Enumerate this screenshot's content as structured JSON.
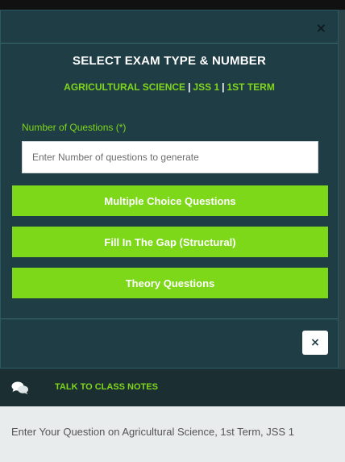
{
  "modal": {
    "close_glyph": "×",
    "title": "SELECT EXAM TYPE & NUMBER",
    "subtitle": {
      "subject": "AGRICULTURAL SCIENCE",
      "class": "JSS 1",
      "term": "1ST TERM",
      "separator": "|"
    },
    "field_label": "Number of Questions (*)",
    "questions_input": {
      "placeholder": "Enter Number of questions to generate",
      "value": ""
    },
    "buttons": {
      "multiple_choice": "Multiple Choice Questions",
      "fill_in_gap": "Fill In The Gap (Structural)",
      "theory": "Theory Questions"
    },
    "footer_close_glyph": "×"
  },
  "chat": {
    "icon": "chat-bubbles-icon",
    "link_label": "TALK TO CLASS NOTES"
  },
  "question_box": {
    "placeholder_text": "Enter Your Question on Agricultural Science, 1st Term, JSS 1"
  },
  "colors": {
    "accent_green": "#7ed81a",
    "modal_bg": "#1f3d45"
  }
}
